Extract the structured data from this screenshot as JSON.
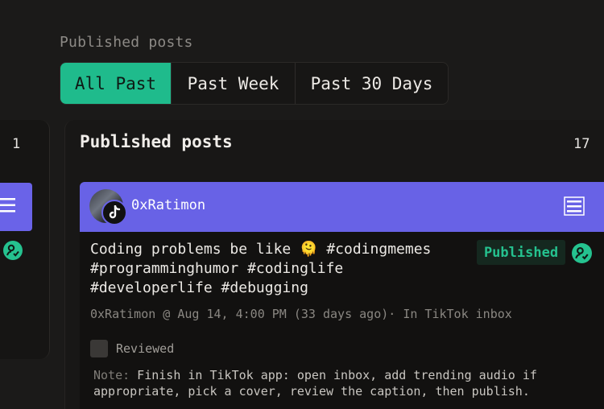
{
  "section": {
    "label": "Published posts"
  },
  "tabs": [
    {
      "label": "All Past",
      "active": true
    },
    {
      "label": "Past Week",
      "active": false
    },
    {
      "label": "Past 30 Days",
      "active": false
    }
  ],
  "left_column": {
    "count": "1"
  },
  "column": {
    "title": "Published posts",
    "count": "17"
  },
  "card": {
    "author": "0xRatimon",
    "platform_icon": "tiktok-icon",
    "caption_lines": [
      "Coding problems be like 🫠 #codingmemes",
      "#programminghumor #codinglife",
      "#developerlife #debugging"
    ],
    "status": "Published",
    "meta": "0xRatimon @ Aug 14, 4:00 PM (33 days ago)· In TikTok inbox",
    "reviewed_label": "Reviewed",
    "reviewed_checked": false,
    "note_label": "Note:",
    "note_text": " Finish in TikTok app: open inbox, add trending audio if appropriate, pick a cover, review the caption, then publish."
  },
  "colors": {
    "accent": "#1fbb8c",
    "header": "#6862e6",
    "badge_text": "#25c28f",
    "background": "#1b1a19"
  }
}
